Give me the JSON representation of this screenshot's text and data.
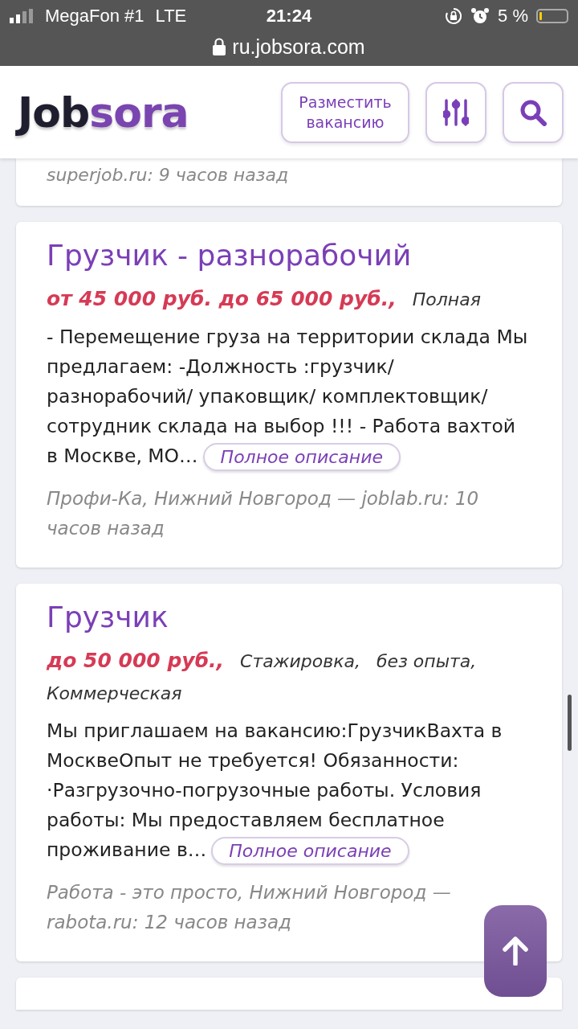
{
  "status_bar": {
    "carrier": "MegaFon #1",
    "network": "LTE",
    "time": "21:24",
    "battery_percent": "5 %"
  },
  "address_bar": {
    "url": "ru.jobsora.com"
  },
  "header": {
    "logo": [
      "Job",
      "sora"
    ],
    "post_button": "Разместить вакансию"
  },
  "partial_card": {
    "source": "superjob.ru: 9 часов назад"
  },
  "jobs": [
    {
      "title": "Грузчик - разнорабочий",
      "salary": "от 45 000 руб. до 65 000 руб.,",
      "tags": [
        "Полная"
      ],
      "description": "- Перемещение груза на территории склада Мы предлагаем: -Должность :грузчик/ разнорабочий/ упаковщик/ комплектовщик/ сотрудник склада на выбор !!! - Работа вахтой в Москве, МО…",
      "more": "Полное описание",
      "source": "Профи-Ка, Нижний Новгород — joblab.ru: 10 часов назад"
    },
    {
      "title": "Грузчик",
      "salary": "до 50 000 руб.,",
      "tags": [
        "Стажировка,",
        "без опыта,",
        "Коммерческая"
      ],
      "description": "Мы приглашаем на вакансию:ГрузчикВахта в МосквеОпыт не требуется!  Обязанности: ·Разгрузочно-погрузочные работы.  Условия работы: Мы предоставляем бесплатное проживание в…",
      "more": "Полное описание",
      "source": "Работа - это просто, Нижний Новгород — rabota.ru: 12 часов назад"
    }
  ]
}
